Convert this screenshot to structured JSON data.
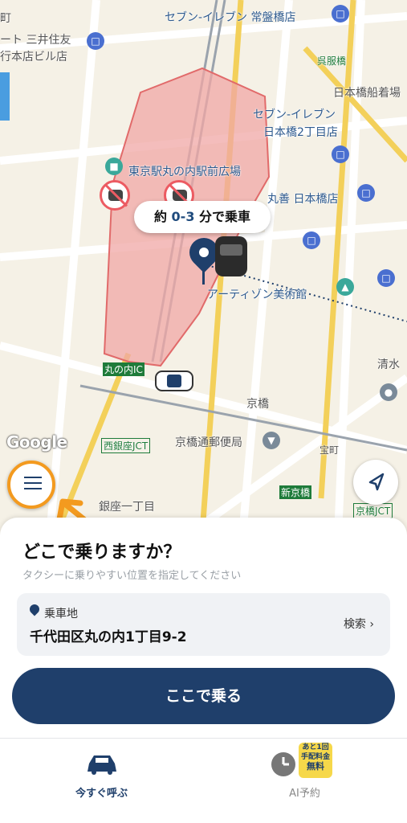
{
  "map": {
    "labels": [
      {
        "text": "セブン-イレブン 常盤橋店"
      },
      {
        "text": "ート 三井住友"
      },
      {
        "text": "行本店ビル店"
      },
      {
        "text": "呉服橋"
      },
      {
        "text": "日本橋船着場"
      },
      {
        "text": "セブン-イレブン"
      },
      {
        "text": "日本橋2丁目店"
      },
      {
        "text": "東京駅丸の内駅前広場"
      },
      {
        "text": "丸善 日本橋店"
      },
      {
        "text": "アーティゾン美術館"
      },
      {
        "text": "丸の内IC"
      },
      {
        "text": "京橋"
      },
      {
        "text": "清水"
      },
      {
        "text": "西銀座JCT"
      },
      {
        "text": "京橋通郵便局"
      },
      {
        "text": "宝町"
      },
      {
        "text": "新京橋"
      },
      {
        "text": "銀座一丁目"
      },
      {
        "text": "京橋JCT"
      },
      {
        "text": "町"
      }
    ],
    "google_logo": "Google",
    "eta_prefix": "約",
    "eta_value": "0-3",
    "eta_suffix": "分で乗車"
  },
  "sheet": {
    "question": "どこで乗りますか？",
    "hint": "タクシーに乗りやすい位置を指定してください",
    "pickup_label": "乗車地",
    "pickup_address": "千代田区丸の内1丁目9-2",
    "search_label": "検索",
    "ride_button": "ここで乗る"
  },
  "tabs": {
    "now": "今すぐ呼ぶ",
    "ai": "AI予約",
    "badge_line1": "あと1回",
    "badge_line2": "手配料金",
    "badge_line3": "無料"
  }
}
